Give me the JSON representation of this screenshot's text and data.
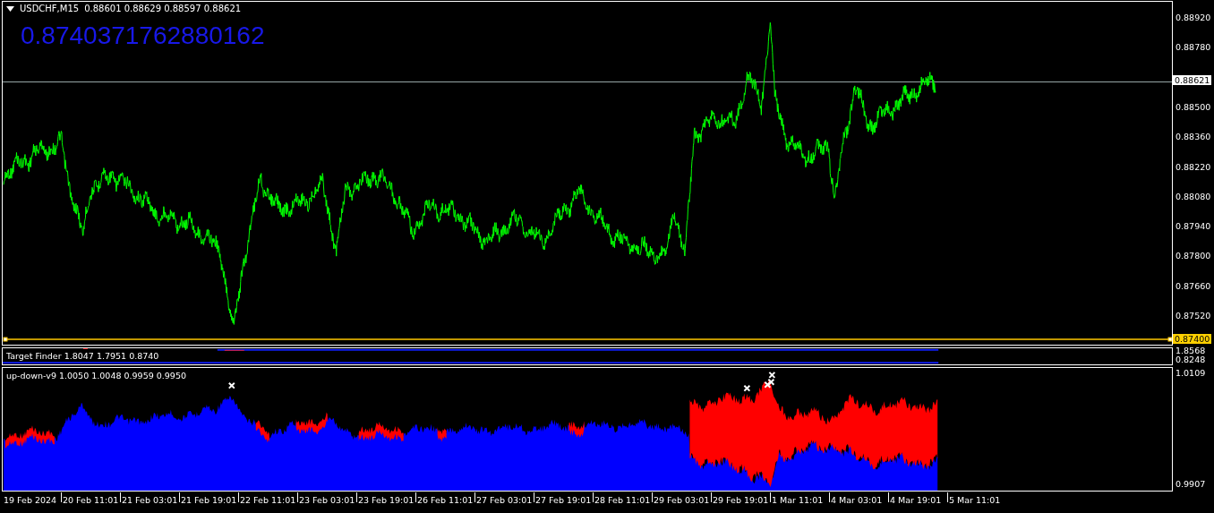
{
  "main_chart": {
    "symbol": "USDCHF,M15",
    "ohlc": "0.88601 0.88629 0.88597 0.88621",
    "big_value": "0.8740371762880162",
    "price_axis": [
      "0.88920",
      "0.88780",
      "0.88500",
      "0.88360",
      "0.88220",
      "0.88080",
      "0.87940",
      "0.87800",
      "0.87660",
      "0.87520"
    ],
    "current_price": "0.88621",
    "level_line": "0.87400"
  },
  "indicators": [
    {
      "label": "Target Finder 1.8047 1.7951 0.8740",
      "axis": [
        "1.8568",
        "0.8248"
      ]
    },
    {
      "label": "up-down-v9 1.0050 1.0048 0.9959 0.9950",
      "axis": [
        "1.0109",
        "0.9907"
      ]
    }
  ],
  "time_axis": [
    "19 Feb 2024",
    "20 Feb 11:01",
    "21 Feb 03:01",
    "21 Feb 19:01",
    "22 Feb 11:01",
    "23 Feb 03:01",
    "23 Feb 19:01",
    "26 Feb 11:01",
    "27 Feb 03:01",
    "27 Feb 19:01",
    "28 Feb 11:01",
    "29 Feb 03:01",
    "29 Feb 19:01",
    "1 Mar 11:01",
    "4 Mar 03:01",
    "4 Mar 19:01",
    "5 Mar 11:01"
  ]
}
